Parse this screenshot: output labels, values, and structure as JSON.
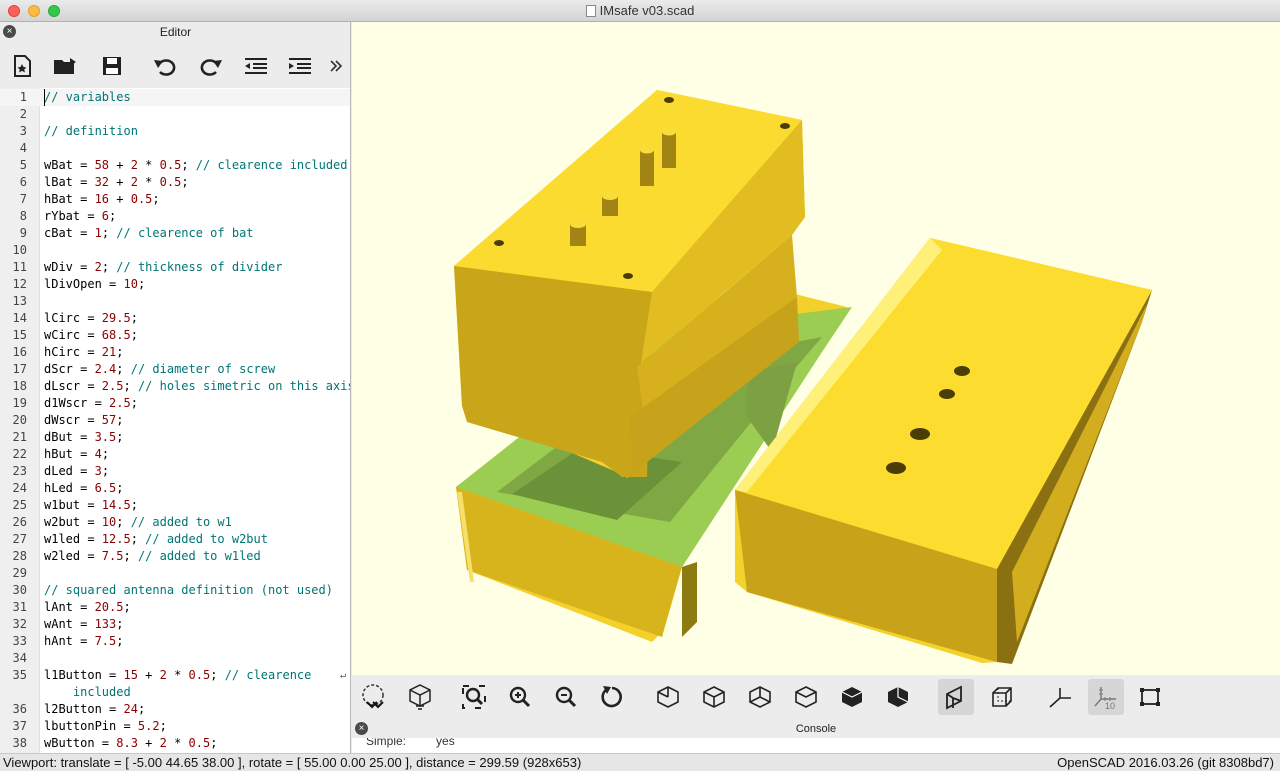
{
  "window": {
    "title": "IMsafe v03.scad"
  },
  "editor": {
    "title": "Editor",
    "toolbar": [
      "new-file",
      "open-file",
      "save-file",
      "undo",
      "redo",
      "unindent",
      "indent",
      "more"
    ],
    "lines": [
      {
        "n": "1",
        "segs": [
          [
            "c",
            "// variables"
          ]
        ]
      },
      {
        "n": "2",
        "segs": []
      },
      {
        "n": "3",
        "segs": [
          [
            "c",
            "// definition"
          ]
        ]
      },
      {
        "n": "4",
        "segs": []
      },
      {
        "n": "5",
        "segs": [
          [
            "t",
            "wBat = "
          ],
          [
            "n",
            "58"
          ],
          [
            "t",
            " + "
          ],
          [
            "n",
            "2"
          ],
          [
            "t",
            " * "
          ],
          [
            "n",
            "0.5"
          ],
          [
            "t",
            "; "
          ],
          [
            "c",
            "// clearence included"
          ]
        ]
      },
      {
        "n": "6",
        "segs": [
          [
            "t",
            "lBat = "
          ],
          [
            "n",
            "32"
          ],
          [
            "t",
            " + "
          ],
          [
            "n",
            "2"
          ],
          [
            "t",
            " * "
          ],
          [
            "n",
            "0.5"
          ],
          [
            "t",
            ";"
          ]
        ]
      },
      {
        "n": "7",
        "segs": [
          [
            "t",
            "hBat = "
          ],
          [
            "n",
            "16"
          ],
          [
            "t",
            " + "
          ],
          [
            "n",
            "0.5"
          ],
          [
            "t",
            ";"
          ]
        ]
      },
      {
        "n": "8",
        "segs": [
          [
            "t",
            "rYbat = "
          ],
          [
            "n",
            "6"
          ],
          [
            "t",
            ";"
          ]
        ]
      },
      {
        "n": "9",
        "segs": [
          [
            "t",
            "cBat = "
          ],
          [
            "n",
            "1"
          ],
          [
            "t",
            "; "
          ],
          [
            "c",
            "// clearence of bat"
          ]
        ]
      },
      {
        "n": "10",
        "segs": []
      },
      {
        "n": "11",
        "segs": [
          [
            "t",
            "wDiv = "
          ],
          [
            "n",
            "2"
          ],
          [
            "t",
            "; "
          ],
          [
            "c",
            "// thickness of divider"
          ]
        ]
      },
      {
        "n": "12",
        "segs": [
          [
            "t",
            "lDivOpen = "
          ],
          [
            "n",
            "10"
          ],
          [
            "t",
            ";"
          ]
        ]
      },
      {
        "n": "13",
        "segs": []
      },
      {
        "n": "14",
        "segs": [
          [
            "t",
            "lCirc = "
          ],
          [
            "n",
            "29.5"
          ],
          [
            "t",
            ";"
          ]
        ]
      },
      {
        "n": "15",
        "segs": [
          [
            "t",
            "wCirc = "
          ],
          [
            "n",
            "68.5"
          ],
          [
            "t",
            ";"
          ]
        ]
      },
      {
        "n": "16",
        "segs": [
          [
            "t",
            "hCirc = "
          ],
          [
            "n",
            "21"
          ],
          [
            "t",
            ";"
          ]
        ]
      },
      {
        "n": "17",
        "segs": [
          [
            "t",
            "dScr = "
          ],
          [
            "n",
            "2.4"
          ],
          [
            "t",
            "; "
          ],
          [
            "c",
            "// diameter of screw"
          ]
        ]
      },
      {
        "n": "18",
        "segs": [
          [
            "t",
            "dLscr = "
          ],
          [
            "n",
            "2.5"
          ],
          [
            "t",
            "; "
          ],
          [
            "c",
            "// holes simetric on this axis"
          ]
        ]
      },
      {
        "n": "19",
        "segs": [
          [
            "t",
            "d1Wscr = "
          ],
          [
            "n",
            "2.5"
          ],
          [
            "t",
            ";"
          ]
        ]
      },
      {
        "n": "20",
        "segs": [
          [
            "t",
            "dWscr = "
          ],
          [
            "n",
            "57"
          ],
          [
            "t",
            ";"
          ]
        ]
      },
      {
        "n": "21",
        "segs": [
          [
            "t",
            "dBut = "
          ],
          [
            "n",
            "3.5"
          ],
          [
            "t",
            ";"
          ]
        ]
      },
      {
        "n": "22",
        "segs": [
          [
            "t",
            "hBut = "
          ],
          [
            "n",
            "4"
          ],
          [
            "t",
            ";"
          ]
        ]
      },
      {
        "n": "23",
        "segs": [
          [
            "t",
            "dLed = "
          ],
          [
            "n",
            "3"
          ],
          [
            "t",
            ";"
          ]
        ]
      },
      {
        "n": "24",
        "segs": [
          [
            "t",
            "hLed = "
          ],
          [
            "n",
            "6.5"
          ],
          [
            "t",
            ";"
          ]
        ]
      },
      {
        "n": "25",
        "segs": [
          [
            "t",
            "w1but = "
          ],
          [
            "n",
            "14.5"
          ],
          [
            "t",
            ";"
          ]
        ]
      },
      {
        "n": "26",
        "segs": [
          [
            "t",
            "w2but = "
          ],
          [
            "n",
            "10"
          ],
          [
            "t",
            "; "
          ],
          [
            "c",
            "// added to w1"
          ]
        ]
      },
      {
        "n": "27",
        "segs": [
          [
            "t",
            "w1led = "
          ],
          [
            "n",
            "12.5"
          ],
          [
            "t",
            "; "
          ],
          [
            "c",
            "// added to w2but"
          ]
        ]
      },
      {
        "n": "28",
        "segs": [
          [
            "t",
            "w2led = "
          ],
          [
            "n",
            "7.5"
          ],
          [
            "t",
            "; "
          ],
          [
            "c",
            "// added to w1led"
          ]
        ]
      },
      {
        "n": "29",
        "segs": []
      },
      {
        "n": "30",
        "segs": [
          [
            "c",
            "// squared antenna definition (not used)"
          ]
        ]
      },
      {
        "n": "31",
        "segs": [
          [
            "t",
            "lAnt = "
          ],
          [
            "n",
            "20.5"
          ],
          [
            "t",
            ";"
          ]
        ]
      },
      {
        "n": "32",
        "segs": [
          [
            "t",
            "wAnt = "
          ],
          [
            "n",
            "133"
          ],
          [
            "t",
            ";"
          ]
        ]
      },
      {
        "n": "33",
        "segs": [
          [
            "t",
            "hAnt = "
          ],
          [
            "n",
            "7.5"
          ],
          [
            "t",
            ";"
          ]
        ]
      },
      {
        "n": "34",
        "segs": []
      },
      {
        "n": "35",
        "segs": [
          [
            "t",
            "l1Button = "
          ],
          [
            "n",
            "15"
          ],
          [
            "t",
            " + "
          ],
          [
            "n",
            "2"
          ],
          [
            "t",
            " * "
          ],
          [
            "n",
            "0.5"
          ],
          [
            "t",
            "; "
          ],
          [
            "c",
            "// clearence"
          ]
        ]
      },
      {
        "n": "",
        "segs": [
          [
            "c",
            "    included"
          ]
        ]
      },
      {
        "n": "36",
        "segs": [
          [
            "t",
            "l2Button = "
          ],
          [
            "n",
            "24"
          ],
          [
            "t",
            ";"
          ]
        ]
      },
      {
        "n": "37",
        "segs": [
          [
            "t",
            "lbuttonPin = "
          ],
          [
            "n",
            "5.2"
          ],
          [
            "t",
            ";"
          ]
        ]
      },
      {
        "n": "38",
        "segs": [
          [
            "t",
            "wButton = "
          ],
          [
            "n",
            "8.3"
          ],
          [
            "t",
            " + "
          ],
          [
            "n",
            "2"
          ],
          [
            "t",
            " * "
          ],
          [
            "n",
            "0.5"
          ],
          [
            "t",
            ";"
          ]
        ]
      }
    ]
  },
  "viewport_toolbar": [
    "preview",
    "render",
    "view-all",
    "zoom-in",
    "zoom-out",
    "reset-view",
    "view-right",
    "view-top",
    "view-bottom",
    "view-left",
    "view-front",
    "view-back",
    "perspective",
    "orthogonal",
    "show-axes",
    "show-scale-markers",
    "show-edges"
  ],
  "console": {
    "title": "Console",
    "line_label": "Simple:",
    "line_value": "yes"
  },
  "status": {
    "left": "Viewport: translate = [ -5.00 44.65 38.00 ], rotate = [ 55.00 0.00 25.00 ], distance = 299.59 (928x653)",
    "right": "OpenSCAD 2016.03.26 (git 8308bd7)"
  },
  "colors": {
    "viewport_bg": "#ffffe5",
    "model_yellow": "#f9d82e",
    "model_green": "#9acd52",
    "comment": "#007575",
    "number": "#8b0000"
  }
}
